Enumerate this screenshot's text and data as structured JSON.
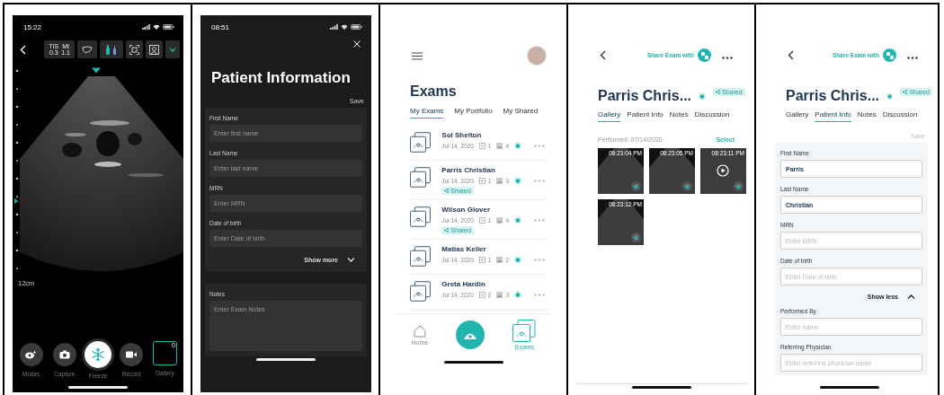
{
  "scanner": {
    "status_time": "15:22",
    "indices": [
      {
        "label": "TIS",
        "value": "0.3"
      },
      {
        "label": "MI",
        "value": "1.1"
      }
    ],
    "depth": "12cm",
    "actions": [
      {
        "kind": "modes",
        "label": "Modes"
      },
      {
        "kind": "capture",
        "label": "Capture"
      },
      {
        "kind": "freeze",
        "label": "Freeze"
      },
      {
        "kind": "record",
        "label": "Record"
      },
      {
        "kind": "gallery",
        "label": "Gallery",
        "count": "0"
      }
    ]
  },
  "patient_form": {
    "status_time": "08:51",
    "title": "Patient Information",
    "save": "Save",
    "fields": [
      {
        "label": "First Name",
        "placeholder": "Enter first name"
      },
      {
        "label": "Last Name",
        "placeholder": "Enter last name"
      },
      {
        "label": "MRN",
        "placeholder": "Enter MRN"
      },
      {
        "label": "Date of birth",
        "placeholder": "Enter Date of birth"
      }
    ],
    "toggle": {
      "label": "Show more",
      "expanded": false
    },
    "notes": {
      "label": "Notes",
      "placeholder": "Enter Exam Notes"
    }
  },
  "exam_list": {
    "title": "Exams",
    "tabs": [
      {
        "label": "My Exams",
        "selected": true
      },
      {
        "label": "My Portfolio",
        "selected": false
      },
      {
        "label": "My Shared",
        "selected": false
      }
    ],
    "exams": [
      {
        "name": "Sol Shelton",
        "date": "Jul 14, 2020",
        "clips": "1",
        "images": "4"
      },
      {
        "name": "Parris Christian",
        "date": "Jul 14, 2020",
        "clips": "1",
        "images": "3",
        "tag": "Shared"
      },
      {
        "name": "Wilson Glover",
        "date": "Jul 14, 2020",
        "clips": "1",
        "images": "4",
        "tag": "Shared"
      },
      {
        "name": "Matias Keller",
        "date": "Jul 14, 2020",
        "clips": "1",
        "images": "2"
      },
      {
        "name": "Greta Hardin",
        "date": "Jul 14, 2020",
        "clips": "2",
        "images": "3"
      }
    ],
    "nav": [
      {
        "kind": "home",
        "label": "Home",
        "selected": false
      },
      {
        "kind": "scan",
        "selected": false
      },
      {
        "kind": "exams",
        "label": "Exams",
        "selected": true
      }
    ]
  },
  "exam_gallery": {
    "share": "Share Exam with",
    "title": "Parris Chris...",
    "tag": "Shared",
    "tabs": [
      {
        "label": "Gallery",
        "selected": true
      },
      {
        "label": "Patient Info",
        "selected": false
      },
      {
        "label": "Notes",
        "selected": false
      },
      {
        "label": "Discussion",
        "selected": false
      }
    ],
    "performed": "Performed: 07/14/2020",
    "select": "Select",
    "thumbnails": [
      {
        "kind": "image",
        "time": "08:23:04 PM"
      },
      {
        "kind": "image",
        "time": "08:23:05 PM"
      },
      {
        "kind": "clip",
        "time": "08:23:11 PM"
      },
      {
        "kind": "image",
        "time": "08:23:12 PM"
      }
    ]
  },
  "exam_info": {
    "share": "Share Exam with",
    "title": "Parris Chris...",
    "tag": "Shared",
    "tabs": [
      {
        "label": "Gallery",
        "selected": false
      },
      {
        "label": "Patient Info",
        "selected": true
      },
      {
        "label": "Notes",
        "selected": false
      },
      {
        "label": "Discussion",
        "selected": false
      }
    ],
    "save": {
      "label": "Save",
      "disabled": true
    },
    "fields": [
      {
        "label": "First Name",
        "value": "Parris"
      },
      {
        "label": "Last Name",
        "value": "Christian"
      },
      {
        "label": "MRN",
        "placeholder": "Enter MRN"
      },
      {
        "label": "Date of birth",
        "placeholder": "Enter Date of birth"
      }
    ],
    "toggle": {
      "label": "Show less",
      "expanded": true
    },
    "more_fields": [
      {
        "label": "Performed By",
        "placeholder": "Enter name"
      },
      {
        "label": "Referring Physician",
        "placeholder": "Enter referring physician name"
      }
    ]
  }
}
